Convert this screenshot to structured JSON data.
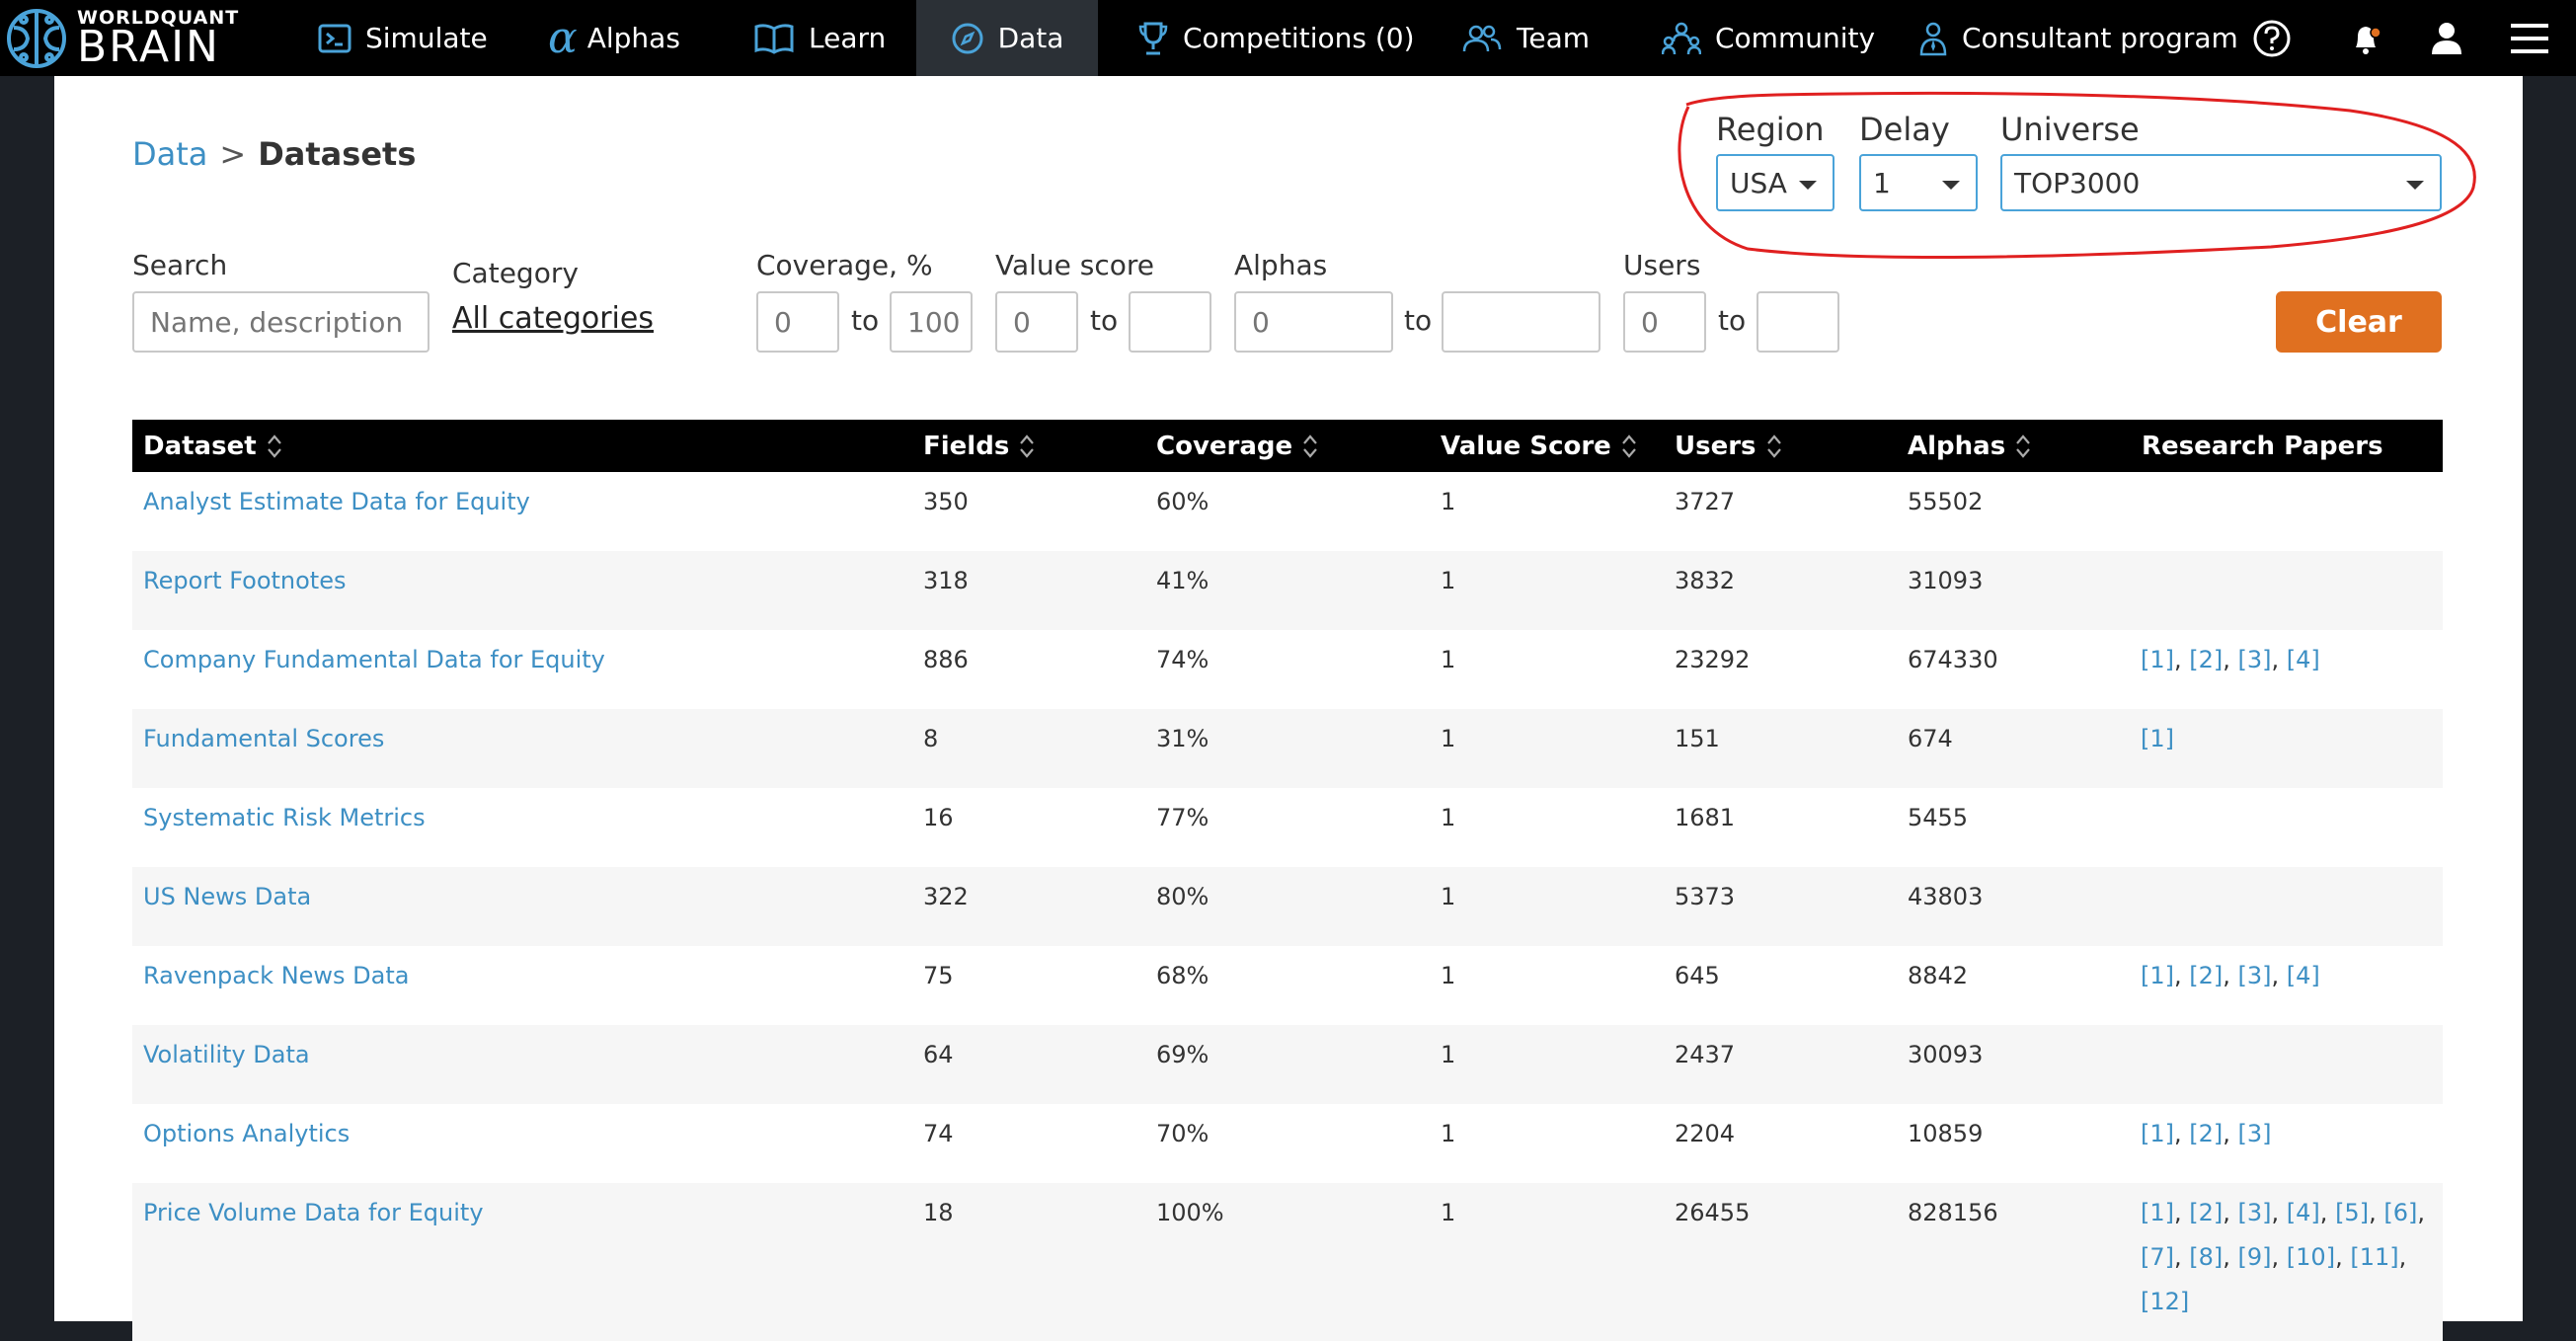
{
  "brand": {
    "line1": "WORLDQUANT",
    "line2": "BRAIN"
  },
  "nav": {
    "items": [
      {
        "label": "Simulate"
      },
      {
        "label": "Alphas"
      },
      {
        "label": "Learn"
      },
      {
        "label": "Data"
      },
      {
        "label": "Competitions (0)"
      },
      {
        "label": "Team"
      },
      {
        "label": "Community"
      },
      {
        "label": "Consultant program"
      }
    ],
    "active": "Data",
    "icons": [
      "help-icon",
      "notification-bell-icon",
      "user-icon",
      "hamburger-menu-icon"
    ]
  },
  "breadcrumb": {
    "parent": "Data",
    "separator": ">",
    "current": "Datasets"
  },
  "selectors": {
    "region": {
      "label": "Region",
      "value": "USA"
    },
    "delay": {
      "label": "Delay",
      "value": "1"
    },
    "universe": {
      "label": "Universe",
      "value": "TOP3000"
    }
  },
  "filters": {
    "search": {
      "label": "Search",
      "placeholder": "Name, description"
    },
    "category": {
      "label": "Category",
      "value": "All categories"
    },
    "coverage": {
      "label": "Coverage, %",
      "min_placeholder": "0",
      "max_placeholder": "100"
    },
    "value_score": {
      "label": "Value score",
      "min_placeholder": "0",
      "max_placeholder": ""
    },
    "alphas": {
      "label": "Alphas",
      "min_placeholder": "0",
      "max_placeholder": ""
    },
    "users": {
      "label": "Users",
      "min_placeholder": "0",
      "max_placeholder": ""
    },
    "to_text": "to",
    "clear_label": "Clear"
  },
  "table": {
    "columns": [
      "Dataset",
      "Fields",
      "Coverage",
      "Value Score",
      "Users",
      "Alphas",
      "Research Papers"
    ],
    "rows": [
      {
        "name": "Analyst Estimate Data for Equity",
        "fields": "350",
        "coverage": "60%",
        "value_score": "1",
        "users": "3727",
        "alphas": "55502",
        "papers": []
      },
      {
        "name": "Report Footnotes",
        "fields": "318",
        "coverage": "41%",
        "value_score": "1",
        "users": "3832",
        "alphas": "31093",
        "papers": []
      },
      {
        "name": "Company Fundamental Data for Equity",
        "fields": "886",
        "coverage": "74%",
        "value_score": "1",
        "users": "23292",
        "alphas": "674330",
        "papers": [
          "[1]",
          "[2]",
          "[3]",
          "[4]"
        ]
      },
      {
        "name": "Fundamental Scores",
        "fields": "8",
        "coverage": "31%",
        "value_score": "1",
        "users": "151",
        "alphas": "674",
        "papers": [
          "[1]"
        ]
      },
      {
        "name": "Systematic Risk Metrics",
        "fields": "16",
        "coverage": "77%",
        "value_score": "1",
        "users": "1681",
        "alphas": "5455",
        "papers": []
      },
      {
        "name": "US News Data",
        "fields": "322",
        "coverage": "80%",
        "value_score": "1",
        "users": "5373",
        "alphas": "43803",
        "papers": []
      },
      {
        "name": "Ravenpack News Data",
        "fields": "75",
        "coverage": "68%",
        "value_score": "1",
        "users": "645",
        "alphas": "8842",
        "papers": [
          "[1]",
          "[2]",
          "[3]",
          "[4]"
        ]
      },
      {
        "name": "Volatility Data",
        "fields": "64",
        "coverage": "69%",
        "value_score": "1",
        "users": "2437",
        "alphas": "30093",
        "papers": []
      },
      {
        "name": "Options Analytics",
        "fields": "74",
        "coverage": "70%",
        "value_score": "1",
        "users": "2204",
        "alphas": "10859",
        "papers": [
          "[1]",
          "[2]",
          "[3]"
        ]
      },
      {
        "name": "Price Volume Data for Equity",
        "fields": "18",
        "coverage": "100%",
        "value_score": "1",
        "users": "26455",
        "alphas": "828156",
        "papers": [
          "[1]",
          "[2]",
          "[3]",
          "[4]",
          "[5]",
          "[6]",
          "[7]",
          "[8]",
          "[9]",
          "[10]",
          "[11]",
          "[12]"
        ]
      }
    ]
  },
  "colors": {
    "link": "#3d8fc4",
    "accent": "#e07020",
    "annotation": "#e02020",
    "nav_bg": "#000000"
  }
}
